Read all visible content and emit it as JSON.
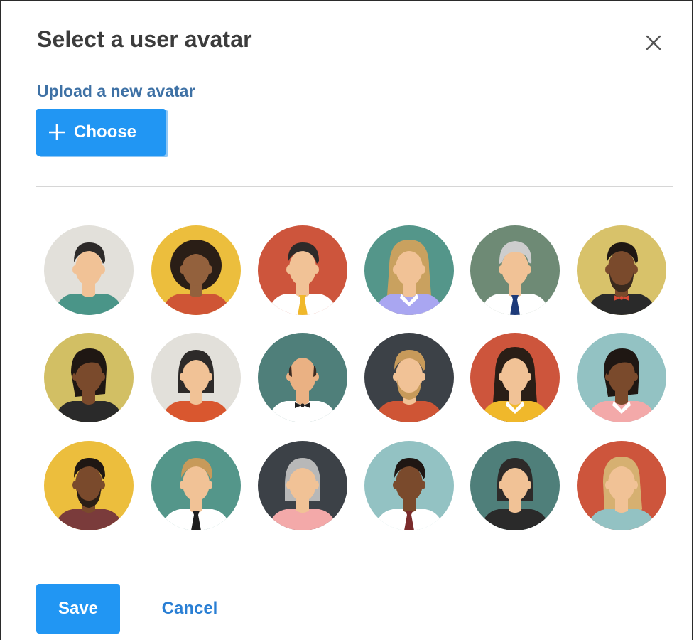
{
  "dialog": {
    "title": "Select a user avatar",
    "close_icon": "close-icon"
  },
  "upload": {
    "label": "Upload a new avatar",
    "choose_label": "Choose",
    "choose_icon": "plus-icon"
  },
  "avatars": [
    {
      "bg": "#e2e0da",
      "skin": "#f1c296",
      "hair": "#2d2a29",
      "shirt": "#4a9588",
      "gender": "m",
      "hairstyle": "short",
      "neck": "none"
    },
    {
      "bg": "#ecbe3d",
      "skin": "#93613d",
      "hair": "#2a1e16",
      "shirt": "#cf5535",
      "gender": "f",
      "hairstyle": "afro",
      "neck": "none"
    },
    {
      "bg": "#cd553c",
      "skin": "#f1c296",
      "hair": "#2d2a29",
      "shirt": "#ffffff",
      "gender": "m",
      "hairstyle": "short",
      "neck": "tie",
      "tie": "#f0b82b"
    },
    {
      "bg": "#54968a",
      "skin": "#f1c296",
      "hair": "#c9a15f",
      "shirt": "#a9a6f1",
      "gender": "f",
      "hairstyle": "long",
      "neck": "collar"
    },
    {
      "bg": "#6e8a75",
      "skin": "#f1c296",
      "hair": "#cdcdcd",
      "shirt": "#ffffff",
      "gender": "m",
      "hairstyle": "gray",
      "neck": "tie",
      "tie": "#1e3b7a"
    },
    {
      "bg": "#d8c26a",
      "skin": "#7a4a2c",
      "hair": "#1f1713",
      "shirt": "#2a2a2a",
      "gender": "m",
      "hairstyle": "short",
      "neck": "bowtie",
      "tie": "#d64a35",
      "beard": "#3a2a1e"
    },
    {
      "bg": "#d2bf64",
      "skin": "#7a4a2c",
      "hair": "#1f1713",
      "shirt": "#2a2a2a",
      "gender": "f",
      "hairstyle": "side",
      "neck": "none"
    },
    {
      "bg": "#e2e0da",
      "skin": "#f1c296",
      "hair": "#2d2a29",
      "shirt": "#d9572f",
      "gender": "f",
      "hairstyle": "bob",
      "neck": "none"
    },
    {
      "bg": "#4f7f7a",
      "skin": "#eab183",
      "hair": "#3b2b22",
      "shirt": "#ffffff",
      "gender": "m",
      "hairstyle": "bald",
      "neck": "bowtie",
      "tie": "#1f1f1f"
    },
    {
      "bg": "#3c4147",
      "skin": "#f1c296",
      "hair": "#c79a5a",
      "shirt": "#cf5535",
      "gender": "m",
      "hairstyle": "short",
      "neck": "none",
      "beard": "#c79a5a"
    },
    {
      "bg": "#cd553c",
      "skin": "#f1c296",
      "hair": "#2a1e16",
      "shirt": "#f0b82b",
      "gender": "f",
      "hairstyle": "long",
      "neck": "collar"
    },
    {
      "bg": "#93c2c3",
      "skin": "#7a4a2c",
      "hair": "#1f1713",
      "shirt": "#f3a9a9",
      "gender": "f",
      "hairstyle": "side",
      "neck": "collar"
    },
    {
      "bg": "#ecbe3d",
      "skin": "#7a4a2c",
      "hair": "#1f1713",
      "shirt": "#7a3b3b",
      "gender": "m",
      "hairstyle": "short",
      "neck": "none",
      "beard": "#2a1e16"
    },
    {
      "bg": "#54968a",
      "skin": "#f1c296",
      "hair": "#c79a5a",
      "shirt": "#ffffff",
      "gender": "m",
      "hairstyle": "short",
      "neck": "tie",
      "tie": "#1f1f1f"
    },
    {
      "bg": "#3c4147",
      "skin": "#f1c296",
      "hair": "#b8b8b8",
      "shirt": "#f3a9a9",
      "gender": "f",
      "hairstyle": "bob",
      "neck": "none"
    },
    {
      "bg": "#93c2c3",
      "skin": "#7a4a2c",
      "hair": "#1f1713",
      "shirt": "#ffffff",
      "gender": "m",
      "hairstyle": "short",
      "neck": "tie",
      "tie": "#7a2b2b"
    },
    {
      "bg": "#4f7f7a",
      "skin": "#f1c296",
      "hair": "#2d2a29",
      "shirt": "#2a2a2a",
      "gender": "f",
      "hairstyle": "bob",
      "neck": "none"
    },
    {
      "bg": "#cd553c",
      "skin": "#f1c296",
      "hair": "#d6b071",
      "shirt": "#93c2c3",
      "gender": "f",
      "hairstyle": "ponytail",
      "neck": "none"
    }
  ],
  "actions": {
    "save_label": "Save",
    "cancel_label": "Cancel"
  }
}
